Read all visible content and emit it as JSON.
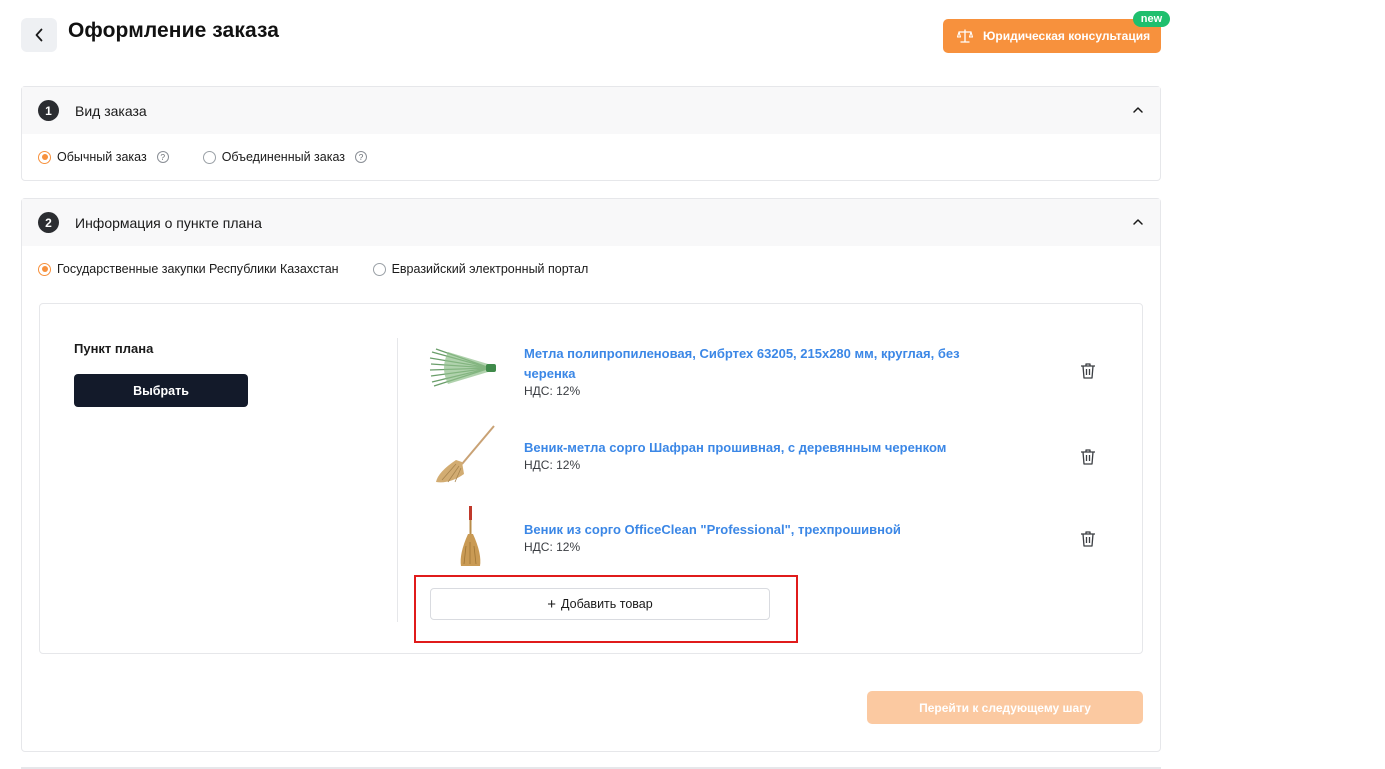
{
  "header": {
    "title": "Оформление заказа",
    "legal_button": "Юридическая консультация",
    "new_badge": "new"
  },
  "section1": {
    "number": "1",
    "title": "Вид заказа",
    "options": [
      {
        "label": "Обычный заказ",
        "checked": true
      },
      {
        "label": "Объединенный заказ",
        "checked": false
      }
    ]
  },
  "section2": {
    "number": "2",
    "title": "Информация о пункте плана",
    "options": [
      {
        "label": "Государственные закупки Республики Казахстан",
        "checked": true
      },
      {
        "label": "Евразийский электронный портал",
        "checked": false
      }
    ],
    "plan_label": "Пункт плана",
    "select_button": "Выбрать",
    "products": [
      {
        "name": "Метла полипропиленовая, Сибртех 63205, 215х280 мм, круглая, без черенка",
        "vat": "НДС: 12%"
      },
      {
        "name": "Веник-метла сорго Шафран прошивная, с деревянным черенком",
        "vat": "НДС: 12%"
      },
      {
        "name": "Веник из сорго OfficeClean \"Professional\", трехпрошивной",
        "vat": "НДС: 12%"
      }
    ],
    "add_button": "Добавить товар",
    "next_button": "Перейти к следующему шагу"
  },
  "icons": {
    "back": "chevron-left-icon",
    "legal": "scales-icon",
    "help": "question-circle-icon",
    "collapse": "chevron-up-icon",
    "delete": "trash-icon",
    "add": "plus-icon"
  },
  "colors": {
    "accent": "#f7913d",
    "link": "#3b87e6",
    "badge": "#1fbf6e",
    "dark_button": "#131a2a",
    "disabled_button": "#fbc9a1"
  }
}
